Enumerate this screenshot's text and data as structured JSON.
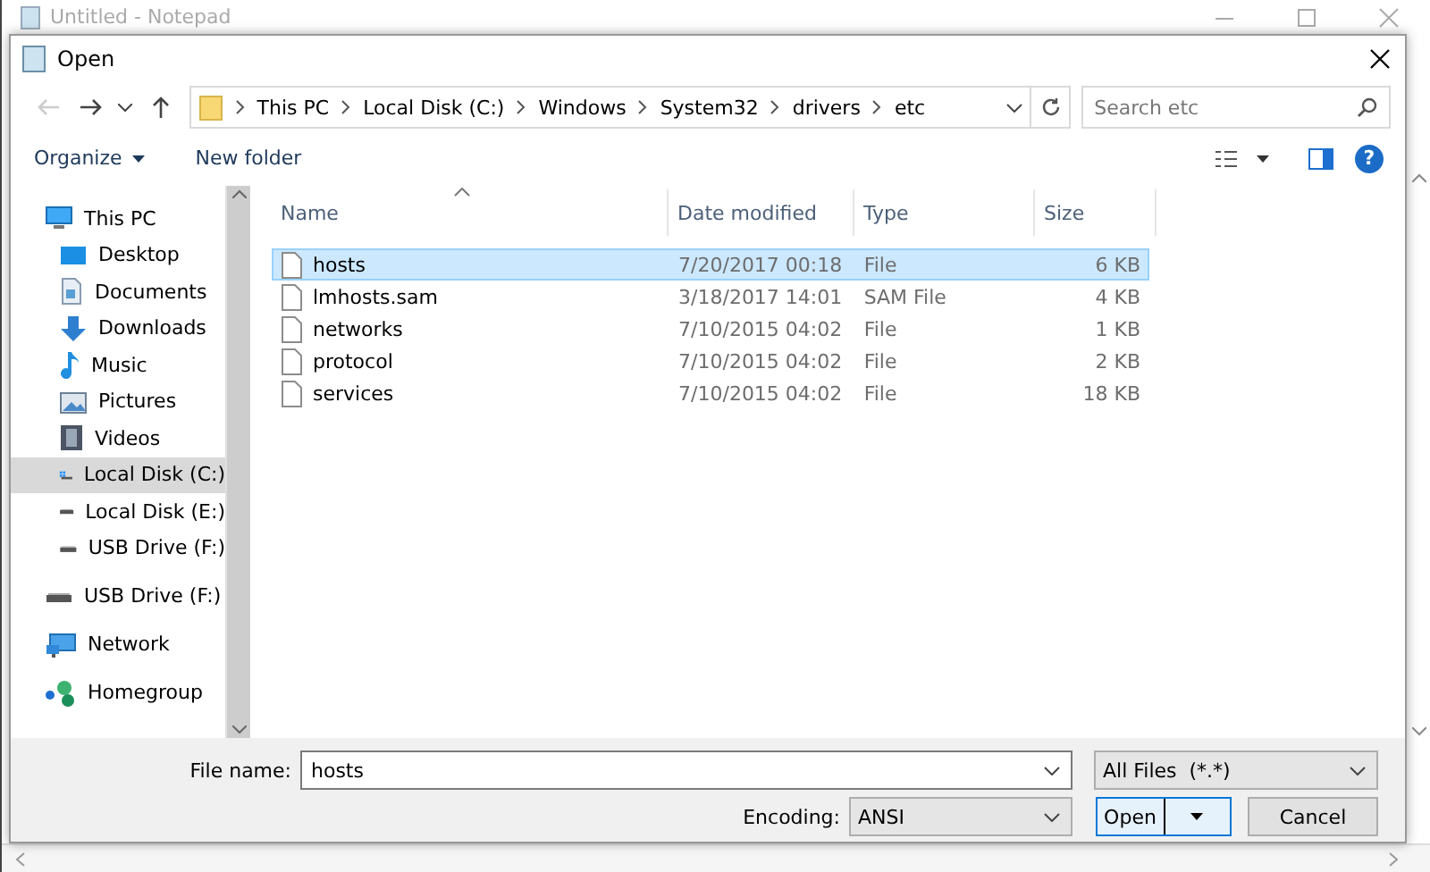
{
  "notepad": {
    "title": "Untitled - Notepad"
  },
  "dialog": {
    "title": "Open"
  },
  "address": {
    "crumbs": [
      "This PC",
      "Local Disk (C:)",
      "Windows",
      "System32",
      "drivers",
      "etc"
    ]
  },
  "search": {
    "placeholder": "Search etc"
  },
  "toolbar": {
    "organize": "Organize",
    "new_folder": "New folder",
    "help": "?"
  },
  "sidebar": {
    "items": [
      {
        "label": "This PC",
        "kind": "pc",
        "selected": false,
        "children": [
          {
            "label": "Desktop",
            "kind": "desktop",
            "selected": false
          },
          {
            "label": "Documents",
            "kind": "documents",
            "selected": false
          },
          {
            "label": "Downloads",
            "kind": "downloads",
            "selected": false
          },
          {
            "label": "Music",
            "kind": "music",
            "selected": false
          },
          {
            "label": "Pictures",
            "kind": "pictures",
            "selected": false
          },
          {
            "label": "Videos",
            "kind": "videos",
            "selected": false
          },
          {
            "label": "Local Disk (C:)",
            "kind": "system-drive",
            "selected": true
          },
          {
            "label": "Local Disk (E:)",
            "kind": "drive",
            "selected": false
          },
          {
            "label": "USB Drive (F:)",
            "kind": "drive",
            "selected": false
          }
        ]
      },
      {
        "label": "USB Drive (F:)",
        "kind": "drive",
        "selected": false
      },
      {
        "label": "Network",
        "kind": "network",
        "selected": false
      },
      {
        "label": "Homegroup",
        "kind": "homegroup",
        "selected": false
      }
    ]
  },
  "table": {
    "columns": [
      {
        "label": "Name",
        "sorted": true
      },
      {
        "label": "Date modified",
        "sorted": false
      },
      {
        "label": "Type",
        "sorted": false
      },
      {
        "label": "Size",
        "sorted": false
      }
    ],
    "rows": [
      {
        "name": "hosts",
        "date": "7/20/2017 00:18",
        "type": "File",
        "size": "6 KB",
        "selected": true
      },
      {
        "name": "lmhosts.sam",
        "date": "3/18/2017 14:01",
        "type": "SAM File",
        "size": "4 KB",
        "selected": false
      },
      {
        "name": "networks",
        "date": "7/10/2015 04:02",
        "type": "File",
        "size": "1 KB",
        "selected": false
      },
      {
        "name": "protocol",
        "date": "7/10/2015 04:02",
        "type": "File",
        "size": "2 KB",
        "selected": false
      },
      {
        "name": "services",
        "date": "7/10/2015 04:02",
        "type": "File",
        "size": "18 KB",
        "selected": false
      }
    ]
  },
  "file_name": {
    "label": "File name:",
    "value": "hosts"
  },
  "filter": {
    "value": "All Files  (*.*)"
  },
  "encoding": {
    "label": "Encoding:",
    "value": "ANSI"
  },
  "buttons": [
    {
      "label": "Open",
      "kind": "split"
    },
    {
      "label": "Cancel",
      "kind": "plain"
    }
  ]
}
